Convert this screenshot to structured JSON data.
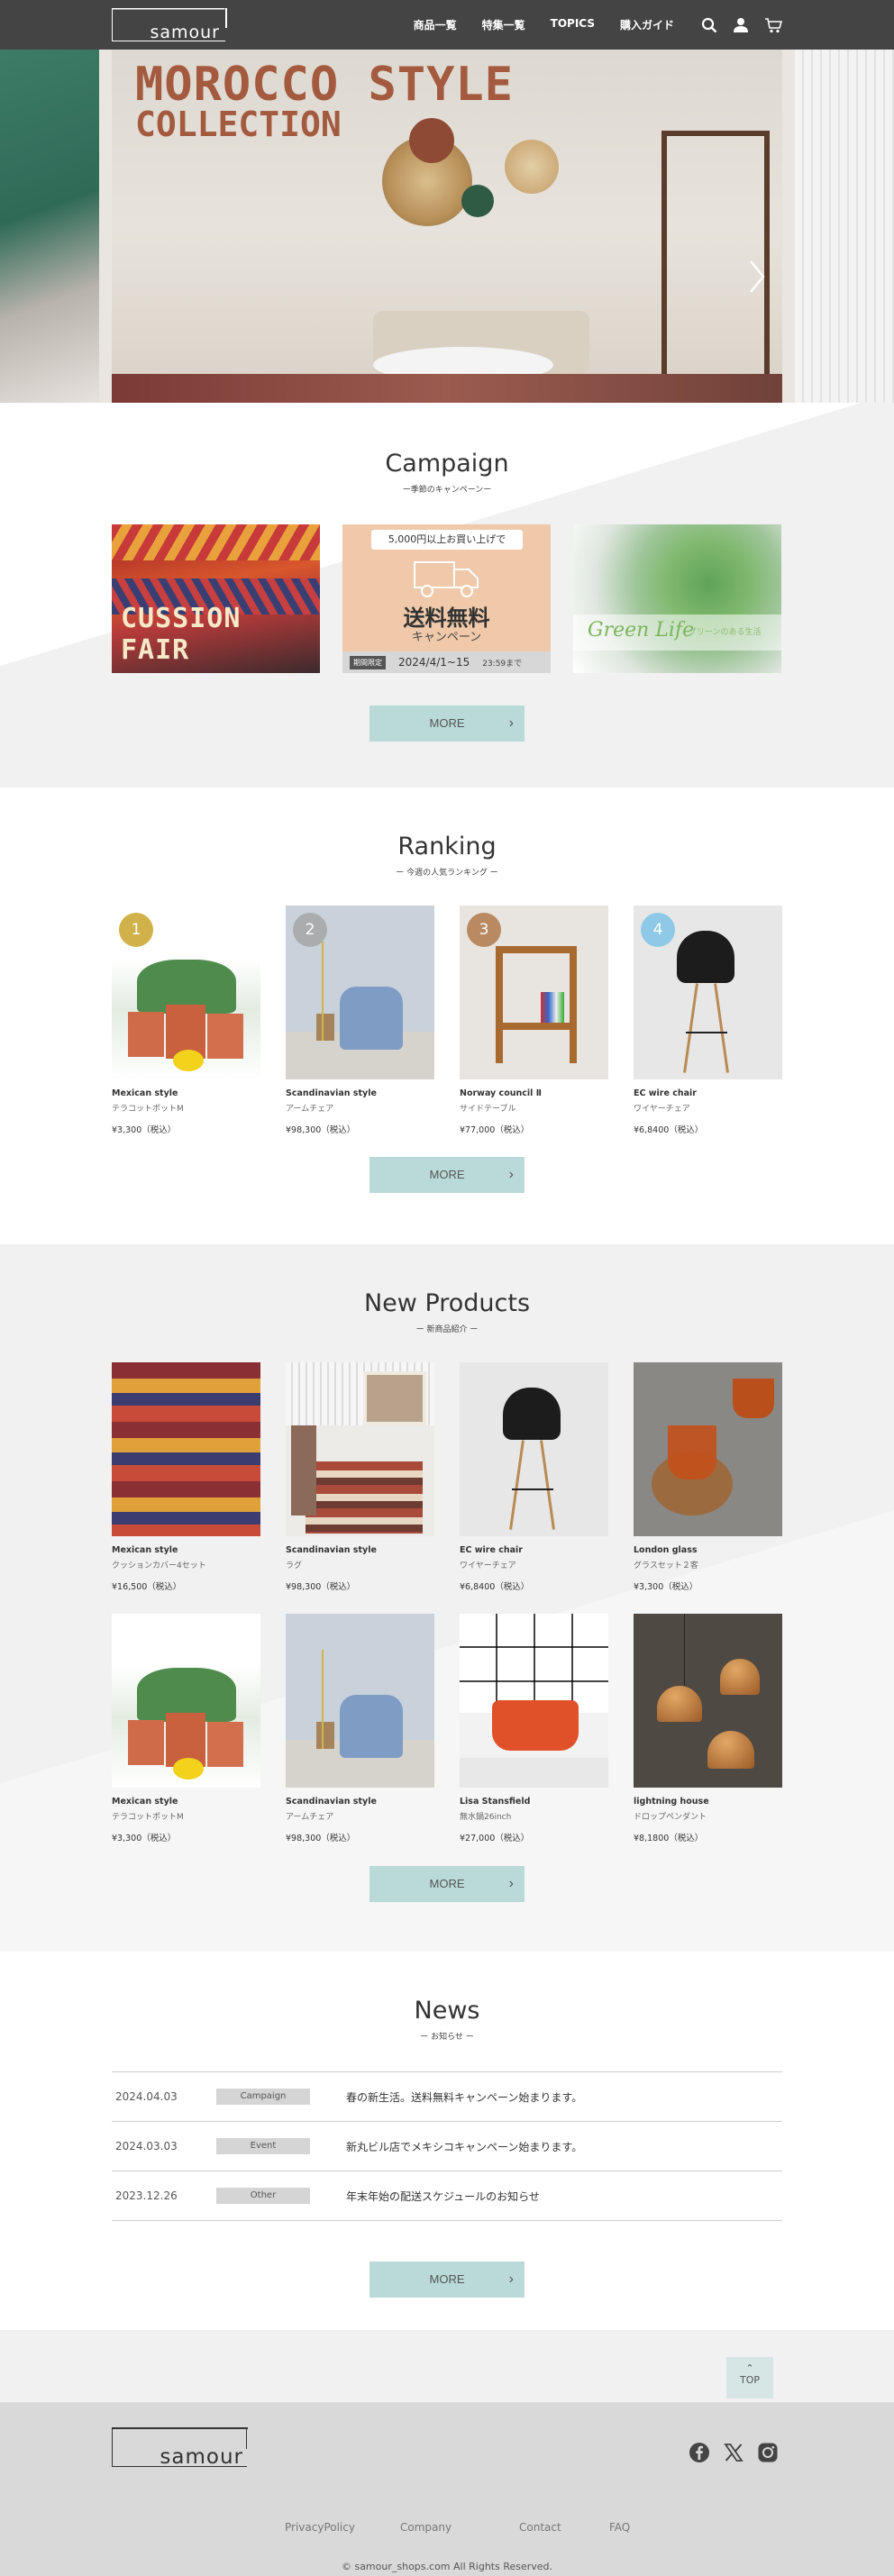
{
  "header": {
    "logo": "samour",
    "nav": [
      "商品一覧",
      "特集一覧",
      "TOPICS",
      "購入ガイド"
    ]
  },
  "hero": {
    "title_line1": "MOROCCO STYLE",
    "title_line2": "COLLECTION",
    "slide_count": 4,
    "active_slide": 1
  },
  "campaign": {
    "title": "Campaign",
    "subtitle": "ー季節のキャンペーンー",
    "card1_text": "CUSSION FAIR",
    "card2": {
      "pill": "5,000円以上お買い上げで",
      "headline": "送料無料",
      "sub": "キャンペーン",
      "tag": "期間限定",
      "dates": "2024/4/1~15",
      "until": "23:59まで"
    },
    "card3": {
      "title": "Green Life",
      "sub": "グリーンのある生活"
    },
    "more": "MORE"
  },
  "ranking": {
    "title": "Ranking",
    "subtitle": "ー 今週の人気ランキング ー",
    "items": [
      {
        "rank": "1",
        "brand": "Mexican style",
        "name": "テラコットポットM",
        "price": "¥3,300（税込）",
        "badge_color": "#c9a42a"
      },
      {
        "rank": "2",
        "brand": "Scandinavian style",
        "name": "アームチェア",
        "price": "¥98,300（税込）",
        "badge_color": "#a6a6a6"
      },
      {
        "rank": "3",
        "brand": "Norway council Ⅱ",
        "name": "サイドテーブル",
        "price": "¥77,000（税込）",
        "badge_color": "#b07a4a"
      },
      {
        "rank": "4",
        "brand": "EC wire chair",
        "name": "ワイヤーチェア",
        "price": "¥6,8400（税込）",
        "badge_color": "#7ec3e6"
      }
    ],
    "more": "MORE"
  },
  "new_products": {
    "title": "New Products",
    "subtitle": "ー 新商品紹介 ー",
    "items": [
      {
        "brand": "Mexican style",
        "name": "クッションカバー4セット",
        "price": "¥16,500（税込）"
      },
      {
        "brand": "Scandinavian style",
        "name": "ラグ",
        "price": "¥98,300（税込）"
      },
      {
        "brand": "EC wire chair",
        "name": "ワイヤーチェア",
        "price": "¥6,8400（税込）"
      },
      {
        "brand": "London glass",
        "name": "グラスセット２客",
        "price": "¥3,300（税込）"
      },
      {
        "brand": "Mexican style",
        "name": "テラコットポットM",
        "price": "¥3,300（税込）"
      },
      {
        "brand": "Scandinavian style",
        "name": "アームチェア",
        "price": "¥98,300（税込）"
      },
      {
        "brand": "Lisa Stansfield",
        "name": "無水鍋26inch",
        "price": "¥27,000（税込）"
      },
      {
        "brand": "lightning house",
        "name": "ドロップペンダント",
        "price": "¥8,1800（税込）"
      }
    ],
    "more": "MORE"
  },
  "news": {
    "title": "News",
    "subtitle": "ー お知らせ ー",
    "rows": [
      {
        "date": "2024.04.03",
        "category": "Campaign",
        "text": "春の新生活。送料無料キャンペーン始まります。"
      },
      {
        "date": "2024.03.03",
        "category": "Event",
        "text": "新丸ビル店でメキシコキャンペーン始まります。"
      },
      {
        "date": "2023.12.26",
        "category": "Other",
        "text": "年末年始の配送スケジュールのお知らせ"
      }
    ],
    "more": "MORE"
  },
  "top_button": "TOP",
  "footer": {
    "logo": "samour",
    "links": [
      "PrivacyPolicy",
      "Company",
      "Contact",
      "FAQ"
    ],
    "copyright": "© samour_shops.com All Rights Reserved."
  },
  "colors": {
    "header_bg": "#444444",
    "more_button": "#b9dad8",
    "footer_bg": "#d9d9d9"
  }
}
